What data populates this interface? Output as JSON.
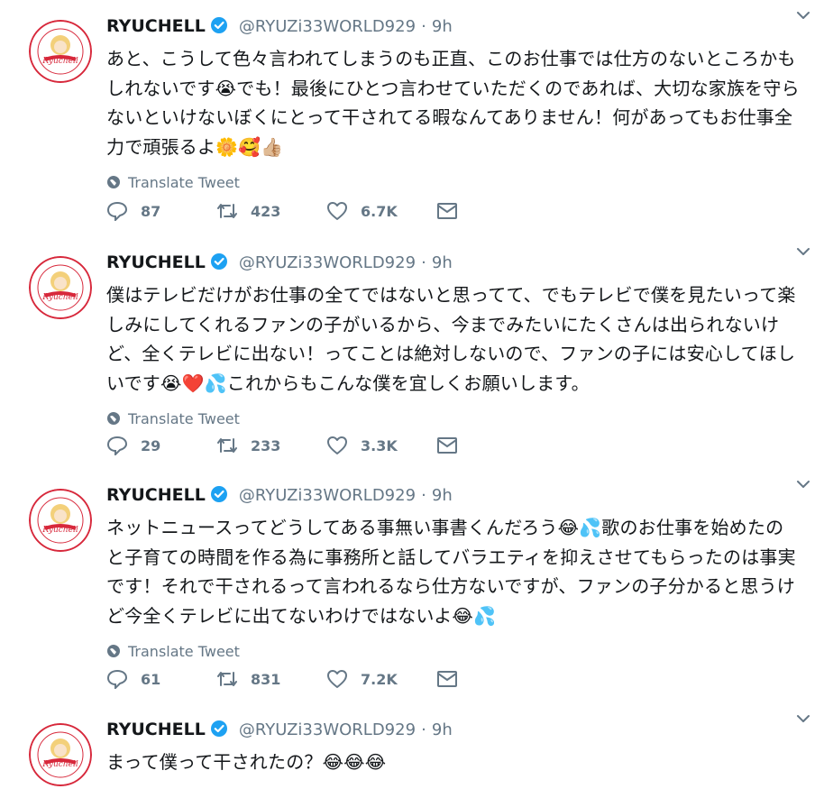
{
  "tweets": [
    {
      "name": "RYUCHELL",
      "handle": "@RYUZi33WORLD929",
      "dot": "·",
      "time": "9h",
      "text": "あと、こうして色々言われてしまうのも正直、このお仕事では仕方のないところかもしれないです😭でも！最後にひとつ言わせていただくのであれば、大切な家族を守らないといけないぼくにとって干されてる暇なんてありません！何があってもお仕事全力で頑張るよ🌼🥰👍🏼",
      "translate": "Translate Tweet",
      "replies": "87",
      "retweets": "423",
      "likes": "6.7K"
    },
    {
      "name": "RYUCHELL",
      "handle": "@RYUZi33WORLD929",
      "dot": "·",
      "time": "9h",
      "text": "僕はテレビだけがお仕事の全てではないと思ってて、でもテレビで僕を見たいって楽しみにしてくれるファンの子がいるから、今までみたいにたくさんは出られないけど、全くテレビに出ない！ってことは絶対しないので、ファンの子には安心してほしいです😭❤️💦これからもこんな僕を宜しくお願いします。",
      "translate": "Translate Tweet",
      "replies": "29",
      "retweets": "233",
      "likes": "3.3K"
    },
    {
      "name": "RYUCHELL",
      "handle": "@RYUZi33WORLD929",
      "dot": "·",
      "time": "9h",
      "text": "ネットニュースってどうしてある事無い事書くんだろう😂💦歌のお仕事を始めたのと子育ての時間を作る為に事務所と話してバラエティを抑えさせてもらったのは事実です！それで干されるって言われるなら仕方ないですが、ファンの子分かると思うけど今全くテレビに出てないわけではないよ😂💦",
      "translate": "Translate Tweet",
      "replies": "61",
      "retweets": "831",
      "likes": "7.2K"
    },
    {
      "name": "RYUCHELL",
      "handle": "@RYUZi33WORLD929",
      "dot": "·",
      "time": "9h",
      "text": "まって僕って干されたの？😂😂😂"
    }
  ],
  "avatar": {
    "ring_text_top": "SUPER CANDY BOY",
    "logo_text": "Ryuchell",
    "ring_text_bottom": "FAMILY ALBUM"
  },
  "colors": {
    "accent": "#1da1f2",
    "muted": "#657786",
    "divider": "#e6ecf0",
    "avatar_red": "#d7283b"
  }
}
